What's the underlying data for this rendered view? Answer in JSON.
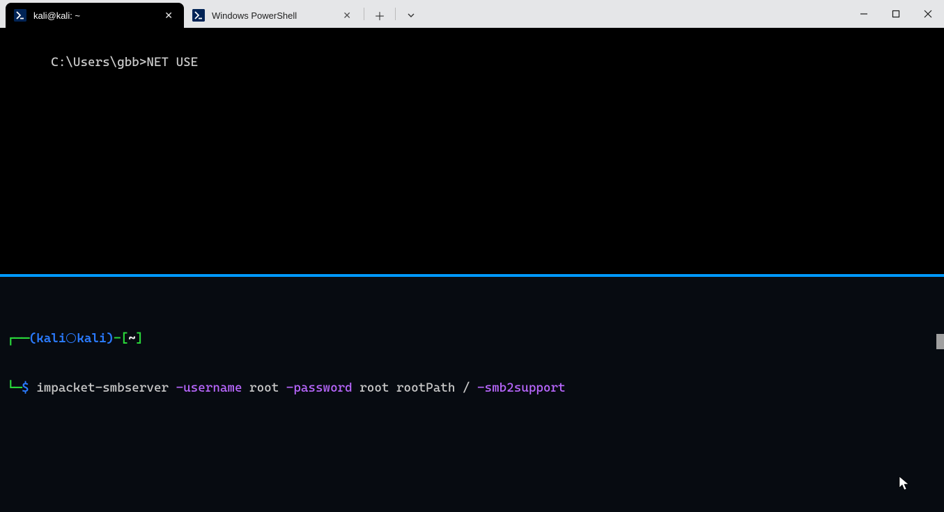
{
  "tabs": [
    {
      "label": "kali@kali: ~",
      "active": true
    },
    {
      "label": "Windows PowerShell",
      "active": false
    }
  ],
  "topPane": {
    "prompt": "C:\\Users\\gbb>",
    "command": "NET USE"
  },
  "bottomPane": {
    "prompt": {
      "openParen": "(",
      "user": "kali",
      "host": "kali",
      "closeParen": ")",
      "dash": "-",
      "openBracket": "[",
      "cwd": "~",
      "closeBracket": "]",
      "topDash": "┌──",
      "sideDash": "└─",
      "dollar": "$"
    },
    "command": {
      "bin": "impacket-smbserver",
      "flag1": "-username",
      "val1": "root",
      "flag2": "-password",
      "val2": "root",
      "share": "rootPath",
      "path": "/",
      "flag3": "-smb2support"
    }
  }
}
